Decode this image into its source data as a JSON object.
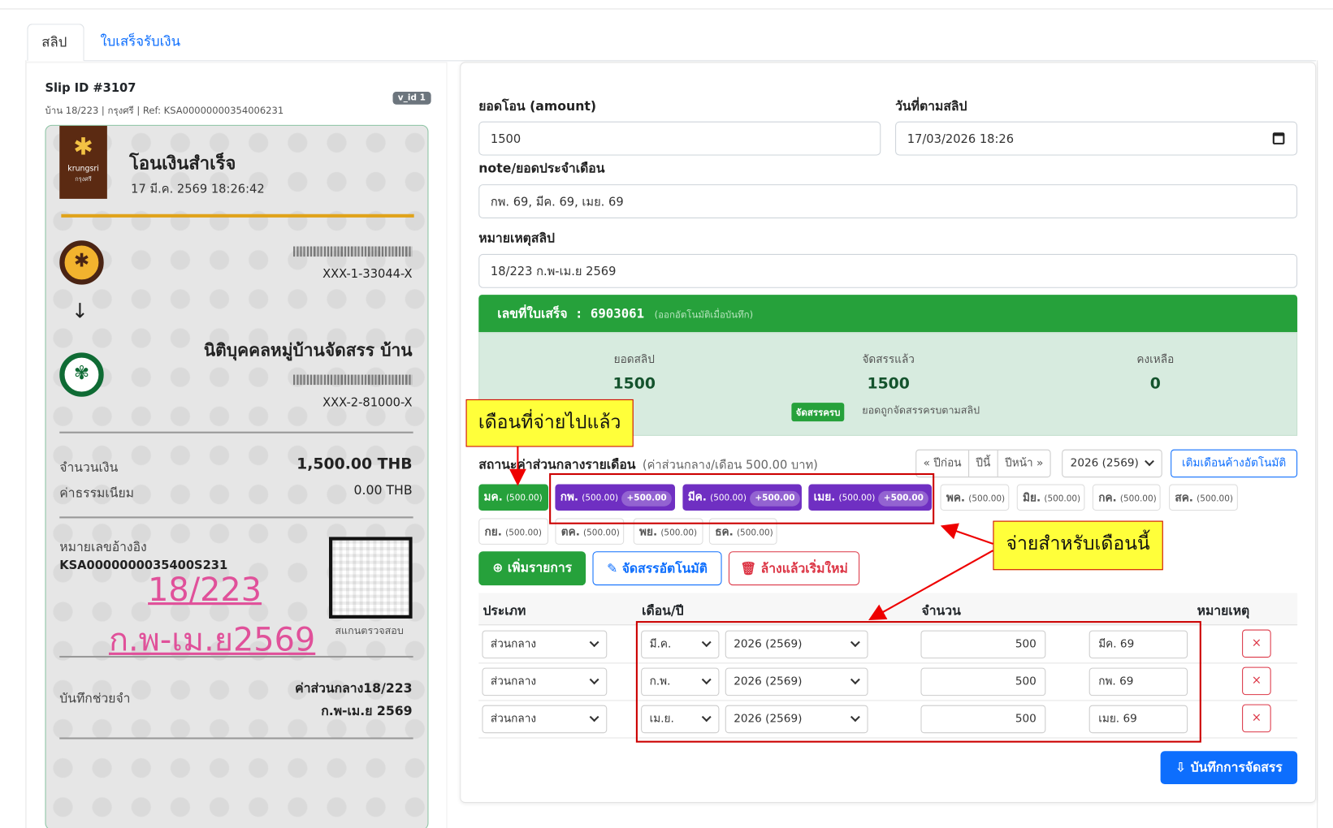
{
  "tabs": {
    "slip": "สลิป",
    "receipt": "ใบเสร็จรับเงิน"
  },
  "slip": {
    "id": "Slip ID #3107",
    "sub": "บ้าน 18/223 | กรุงศรี | Ref: KSA00000000354006231",
    "vid": "v_id 1",
    "bank_name": "krungsri",
    "bank_sub": "กรุงศรี",
    "status": "โอนเงินสำเร็จ",
    "datetime": "17 มี.ค. 2569 18:26:42",
    "from_account": "XXX-1-33044-X",
    "to_name": "นิติบุคคลหมู่บ้านจัดสรร บ้าน",
    "to_account": "XXX-2-81000-X",
    "amount_label": "จำนวนเงิน",
    "amount": "1,500.00 THB",
    "fee_label": "ค่าธรรมเนียม",
    "fee": "0.00 THB",
    "ref_label": "หมายเลขอ้างอิง",
    "ref": "KSA0000000035400S231",
    "qr_label": "สแกนตรวจสอบ",
    "hand1": "18/223",
    "hand2": "ก.พ-เม.ย2569",
    "memo_label": "บันทึกช่วยจำ",
    "memo1": "ค่าส่วนกลาง18/223",
    "memo2": "ก.พ-เม.ย 2569"
  },
  "form": {
    "amount_label": "ยอดโอน (amount)",
    "amount": "1500",
    "date_label": "วันที่ตามสลิป",
    "date": "17/03/2026 18:26",
    "note_label": "note/ยอดประจำเดือน",
    "note": "กพ. 69, มีค. 69, เมย. 69",
    "remark_label": "หมายเหตุสลิป",
    "remark": "18/223 ก.พ-เม.ย 2569"
  },
  "receipt": {
    "label": "เลขที่ใบเสร็จ : 6903061",
    "hint": "(ออกอัตโนมัติเมื่อบันทึก)"
  },
  "summary": {
    "slip_label": "ยอดสลิป",
    "slip": "1500",
    "alloc_label": "จัดสรรแล้ว",
    "alloc": "1500",
    "remain_label": "คงเหลือ",
    "remain": "0",
    "badge": "จัดสรรครบ",
    "badge_text": "ยอดถูกจัดสรรครบตามสลิป"
  },
  "status": {
    "title": "สถานะค่าส่วนกลางรายเดือน",
    "muted": "(ค่าส่วนกลาง/เดือน 500.00 บาท)",
    "prev": "« ปีก่อน",
    "this": "ปีนี้",
    "next": "ปีหน้า »",
    "year": "2026 (2569)",
    "auto": "เติมเดือนค้างอัตโนมัติ",
    "chips": [
      {
        "m": "มค.",
        "a": "(500.00)",
        "plus": "",
        "c": "g"
      },
      {
        "m": "กพ.",
        "a": "(500.00)",
        "plus": "+500.00",
        "c": "p"
      },
      {
        "m": "มีค.",
        "a": "(500.00)",
        "plus": "+500.00",
        "c": "p"
      },
      {
        "m": "เมย.",
        "a": "(500.00)",
        "plus": "+500.00",
        "c": "p"
      },
      {
        "m": "พค.",
        "a": "(500.00)",
        "plus": "",
        "c": "o"
      },
      {
        "m": "มิย.",
        "a": "(500.00)",
        "plus": "",
        "c": "o"
      },
      {
        "m": "กค.",
        "a": "(500.00)",
        "plus": "",
        "c": "o"
      },
      {
        "m": "สค.",
        "a": "(500.00)",
        "plus": "",
        "c": "o"
      },
      {
        "m": "กย.",
        "a": "(500.00)",
        "plus": "",
        "c": "o"
      },
      {
        "m": "ตค.",
        "a": "(500.00)",
        "plus": "",
        "c": "o"
      },
      {
        "m": "พย.",
        "a": "(500.00)",
        "plus": "",
        "c": "o"
      },
      {
        "m": "ธค.",
        "a": "(500.00)",
        "plus": "",
        "c": "o"
      }
    ]
  },
  "annotations": {
    "paid": "เดือนที่จ่ายไปแล้ว",
    "this": "จ่ายสำหรับเดือนนี้"
  },
  "actions": {
    "add": "เพิ่มรายการ",
    "auto": "จัดสรรอัตโนมัติ",
    "clear": "ล้างแล้วเริ่มใหม่"
  },
  "table": {
    "h_type": "ประเภท",
    "h_month": "เดือน/ปี",
    "h_amount": "จำนวน",
    "h_note": "หมายเหตุ",
    "rows": [
      {
        "type": "ส่วนกลาง",
        "month": "มี.ค.",
        "year": "2026 (2569)",
        "amount": "500",
        "note": "มีค. 69"
      },
      {
        "type": "ส่วนกลาง",
        "month": "ก.พ.",
        "year": "2026 (2569)",
        "amount": "500",
        "note": "กพ. 69"
      },
      {
        "type": "ส่วนกลาง",
        "month": "เม.ย.",
        "year": "2026 (2569)",
        "amount": "500",
        "note": "เมย. 69"
      }
    ]
  },
  "save": "บันทึกการจัดสรร"
}
